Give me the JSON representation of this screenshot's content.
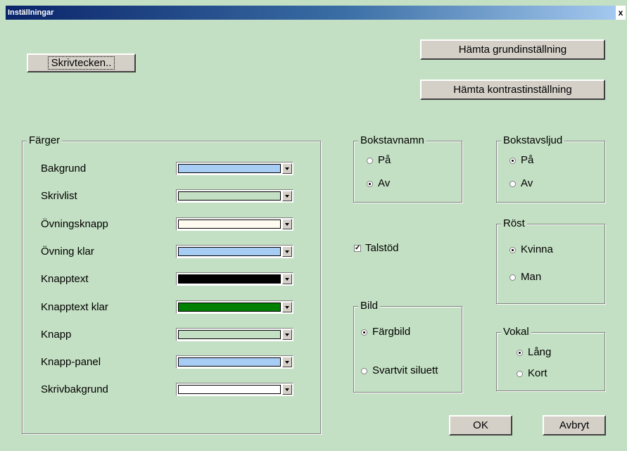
{
  "window": {
    "title": "Inställningar",
    "close_glyph": "x"
  },
  "buttons": {
    "skrivtecken": "Skrivtecken..",
    "grundinstallning": "Hämta grundinställning",
    "kontrastinstallning": "Hämta kontrastinställning",
    "ok": "OK",
    "avbryt": "Avbryt"
  },
  "colors_group": {
    "legend": "Färger",
    "items": [
      {
        "label": "Bakgrund",
        "color": "#a8cdf5"
      },
      {
        "label": "Skrivlist",
        "color": "#c4e0c4"
      },
      {
        "label": "Övningsknapp",
        "color": "#fffbf0"
      },
      {
        "label": "Övning klar",
        "color": "#a8cdf5"
      },
      {
        "label": "Knapptext",
        "color": "#000000"
      },
      {
        "label": "Knapptext klar",
        "color": "#008000"
      },
      {
        "label": "Knapp",
        "color": "#c4e0c4"
      },
      {
        "label": "Knapp-panel",
        "color": "#a8cdf5"
      },
      {
        "label": "Skrivbakgrund",
        "color": "#ffffff"
      }
    ]
  },
  "bokstavnamn": {
    "legend": "Bokstavnamn",
    "on": "På",
    "off": "Av",
    "selected": "off"
  },
  "bokstavsljud": {
    "legend": "Bokstavsljud",
    "on": "På",
    "off": "Av",
    "selected": "on"
  },
  "talstod": {
    "label": "Talstöd",
    "checked": true
  },
  "rost": {
    "legend": "Röst",
    "kvinna": "Kvinna",
    "man": "Man",
    "selected": "kvinna"
  },
  "bild": {
    "legend": "Bild",
    "fargbild": "Färgbild",
    "svartvit": "Svartvit siluett",
    "selected": "fargbild"
  },
  "vokal": {
    "legend": "Vokal",
    "lang": "Lång",
    "kort": "Kort",
    "selected": "lang"
  }
}
